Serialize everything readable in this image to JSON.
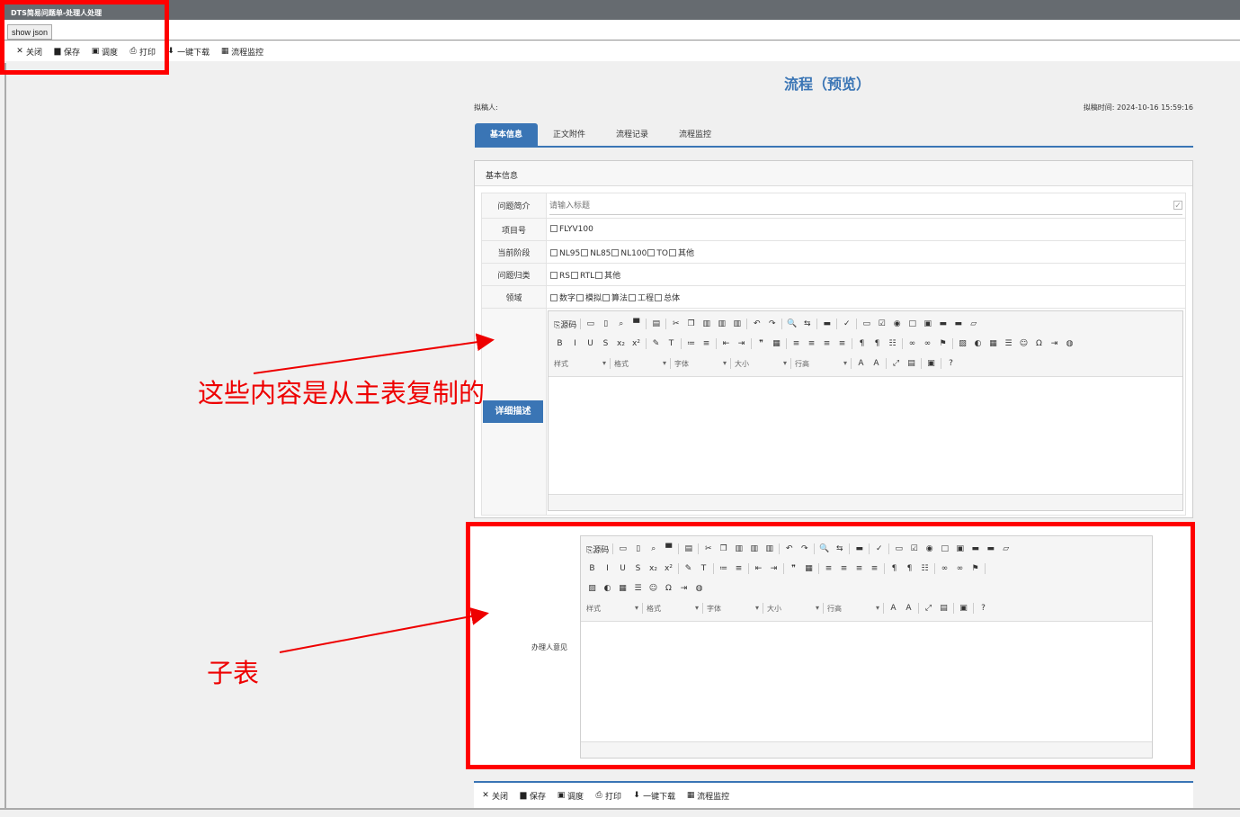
{
  "window": {
    "title": "DTS简易问题单-处理人处理",
    "show_json": "show json"
  },
  "toolbar": [
    {
      "icon": "close-icon",
      "g": "✕",
      "label": "关闭"
    },
    {
      "icon": "save-icon",
      "g": "▆",
      "label": "保存"
    },
    {
      "icon": "dispatch-icon",
      "g": "▣",
      "label": "调度"
    },
    {
      "icon": "print-icon",
      "g": "⎙",
      "label": "打印"
    },
    {
      "icon": "download-icon",
      "g": "⬇",
      "label": "一键下载"
    },
    {
      "icon": "monitor-icon",
      "g": "▦",
      "label": "流程监控"
    }
  ],
  "page": {
    "title": "流程（预览）",
    "drafter": "拟稿人:",
    "draft_time": "拟稿时间:  2024-10-16 15:59:16"
  },
  "tabs": [
    "基本信息",
    "正文附件",
    "流程记录",
    "流程监控"
  ],
  "panel": {
    "header": "基本信息",
    "summary": {
      "label": "问题简介",
      "placeholder": "请输入标题"
    },
    "rows": [
      {
        "label": "项目号",
        "options": [
          "FLYV100"
        ]
      },
      {
        "label": "当前阶段",
        "options": [
          "NL95",
          "NL85",
          "NL100",
          "TO",
          "其他"
        ]
      },
      {
        "label": "问题归类",
        "options": [
          "RS",
          "RTL",
          "其他"
        ]
      },
      {
        "label": "领域",
        "options": [
          "数字",
          "模拟",
          "算法",
          "工程",
          "总体"
        ]
      }
    ],
    "detail_label": "详细描述"
  },
  "editor": {
    "source": "源码",
    "dropdowns": [
      "样式",
      "格式",
      "字体",
      "大小",
      "行高"
    ]
  },
  "subtable": {
    "opinion_label": "办理人意见"
  },
  "annotations": {
    "copied": "这些内容是从主表复制的",
    "subtable": "子表"
  },
  "colors": {
    "accent": "#3a75b5",
    "annotation": "#ff0000"
  }
}
